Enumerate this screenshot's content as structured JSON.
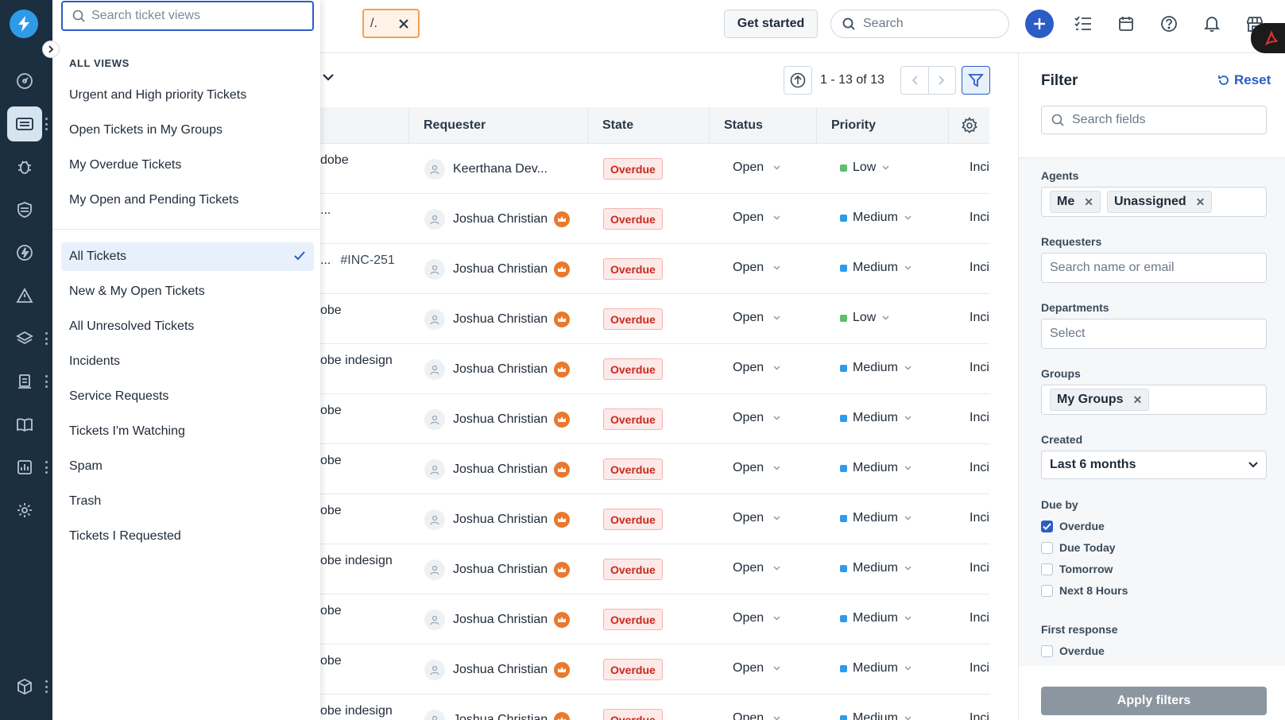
{
  "views_panel": {
    "search_placeholder": "Search ticket views",
    "section_title": "ALL VIEWS",
    "items": [
      "Urgent and High priority Tickets",
      "Open Tickets in My Groups",
      "My Overdue Tickets",
      "My Open and Pending Tickets",
      "All Tickets",
      "New & My Open Tickets",
      "All Unresolved Tickets",
      "Incidents",
      "Service Requests",
      "Tickets I'm Watching",
      "Spam",
      "Trash",
      "Tickets I Requested"
    ],
    "selected": "All Tickets"
  },
  "header": {
    "chip_text": "/.",
    "get_started_label": "Get started",
    "search_label": "Search"
  },
  "toolbar": {
    "pagination": "1 - 13 of 13"
  },
  "table": {
    "columns": [
      "Requester",
      "State",
      "Status",
      "Priority"
    ],
    "rows": [
      {
        "subject": "dobe",
        "requester": "Keerthana Dev...",
        "vip": false,
        "state": "Overdue",
        "status": "Open",
        "priority": "Low",
        "type": "Inci"
      },
      {
        "subject": "...",
        "requester": "Joshua Christian",
        "vip": true,
        "state": "Overdue",
        "status": "Open",
        "priority": "Medium",
        "type": "Inci"
      },
      {
        "subject": "...",
        "subject_num": "#INC-251",
        "requester": "Joshua Christian",
        "vip": true,
        "state": "Overdue",
        "status": "Open",
        "priority": "Medium",
        "type": "Inci"
      },
      {
        "subject": "obe",
        "requester": "Joshua Christian",
        "vip": true,
        "state": "Overdue",
        "status": "Open",
        "priority": "Low",
        "type": "Inci"
      },
      {
        "subject": "obe indesign",
        "requester": "Joshua Christian",
        "vip": true,
        "state": "Overdue",
        "status": "Open",
        "priority": "Medium",
        "type": "Inci"
      },
      {
        "subject": "obe",
        "requester": "Joshua Christian",
        "vip": true,
        "state": "Overdue",
        "status": "Open",
        "priority": "Medium",
        "type": "Inci"
      },
      {
        "subject": "obe",
        "requester": "Joshua Christian",
        "vip": true,
        "state": "Overdue",
        "status": "Open",
        "priority": "Medium",
        "type": "Inci"
      },
      {
        "subject": "obe",
        "requester": "Joshua Christian",
        "vip": true,
        "state": "Overdue",
        "status": "Open",
        "priority": "Medium",
        "type": "Inci"
      },
      {
        "subject": "obe indesign",
        "requester": "Joshua Christian",
        "vip": true,
        "state": "Overdue",
        "status": "Open",
        "priority": "Medium",
        "type": "Inci"
      },
      {
        "subject": "obe",
        "requester": "Joshua Christian",
        "vip": true,
        "state": "Overdue",
        "status": "Open",
        "priority": "Medium",
        "type": "Inci"
      },
      {
        "subject": "obe",
        "requester": "Joshua Christian",
        "vip": true,
        "state": "Overdue",
        "status": "Open",
        "priority": "Medium",
        "type": "Inci"
      },
      {
        "subject": "obe indesign",
        "requester": "Joshua Christian",
        "vip": true,
        "state": "Overdue",
        "status": "Open",
        "priority": "Medium",
        "type": "Inci"
      }
    ]
  },
  "filter": {
    "title": "Filter",
    "reset_label": "Reset",
    "search_placeholder": "Search fields",
    "agents_label": "Agents",
    "agents": [
      "Me",
      "Unassigned"
    ],
    "requesters_label": "Requesters",
    "requesters_placeholder": "Search name or email",
    "departments_label": "Departments",
    "departments_placeholder": "Select",
    "groups_label": "Groups",
    "groups": [
      "My Groups"
    ],
    "created_label": "Created",
    "created_value": "Last 6 months",
    "due_by_label": "Due by",
    "due_by_options": [
      {
        "label": "Overdue",
        "checked": true
      },
      {
        "label": "Due Today",
        "checked": false
      },
      {
        "label": "Tomorrow",
        "checked": false
      },
      {
        "label": "Next 8 Hours",
        "checked": false
      }
    ],
    "first_response_label": "First response",
    "first_response_options": [
      {
        "label": "Overdue",
        "checked": false
      }
    ],
    "apply_label": "Apply filters"
  },
  "colors": {
    "rail_bg": "#1c2f40",
    "accent": "#2c5cc5",
    "overdue_bg": "#fde9e7",
    "overdue_text": "#c8291d",
    "priority_low": "#5fbf6a",
    "priority_medium": "#2f9be8",
    "vip_crown": "#e8792d"
  }
}
